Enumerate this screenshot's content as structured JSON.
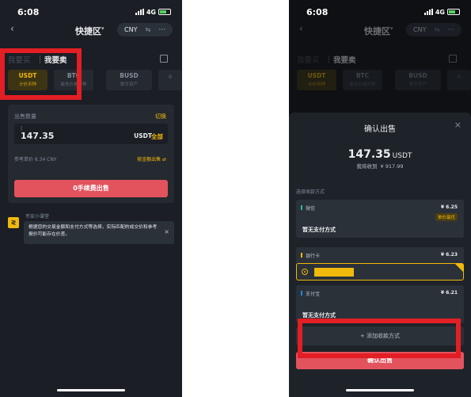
{
  "left": {
    "status": {
      "time": "6:08",
      "network": "4G"
    },
    "nav": {
      "back": "‹",
      "title": "快捷区",
      "caret": "▾",
      "currency": "CNY",
      "swap": "⇆",
      "more": "···"
    },
    "tabs": {
      "buy": "我要买",
      "sell": "我要卖"
    },
    "coins": [
      {
        "symbol": "USDT",
        "sub": "计价币种"
      },
      {
        "symbol": "BTC",
        "sub": "最低价格币种"
      },
      {
        "symbol": "BUSD",
        "sub": "数字资产"
      },
      {
        "symbol": "",
        "sub": "币"
      }
    ],
    "sell_card": {
      "label": "出售数量",
      "switch_label": "切换",
      "cursor": "|",
      "amount": "147.35",
      "unit": "USDT",
      "all_label": "全部",
      "ref_price": "参考单价 6.34 CNY",
      "mode": "按金额出售 ⇄",
      "button": "0手续费出售"
    },
    "tips": {
      "icon": "≷",
      "title": "币安小课堂",
      "text": "根据您的交易金额和支付方式等选择，实际匹配的成交价和参考报价可能存在价差。",
      "close": "×"
    }
  },
  "right": {
    "status": {
      "time": "6:08",
      "network": "4G"
    },
    "nav": {
      "back": "‹",
      "title": "快捷区",
      "caret": "▾",
      "currency": "CNY",
      "swap": "⇆",
      "more": "···"
    },
    "tabs": {
      "buy": "我要买",
      "sell": "我要卖"
    },
    "coins": [
      {
        "symbol": "USDT",
        "sub": "计价币种"
      },
      {
        "symbol": "BTC",
        "sub": "最低价格币种"
      },
      {
        "symbol": "BUSD",
        "sub": "数字资产"
      },
      {
        "symbol": "",
        "sub": "币"
      }
    ],
    "sheet": {
      "title": "确认出售",
      "close": "×",
      "amount": "147.35",
      "currency": "USDT",
      "receive_label": "我将收到",
      "receive_value": "¥ 917.99",
      "method_label": "选择收款方式",
      "methods": [
        {
          "name": "微信",
          "price": "¥ 6.25",
          "badge": "单价最优",
          "status": "暂无支付方式",
          "color": "#2ebd85"
        },
        {
          "name": "银行卡",
          "price": "¥ 6.23",
          "color": "#f0b90b"
        },
        {
          "name": "支付宝",
          "price": "¥ 6.21",
          "status": "暂无支付方式",
          "color": "#1e88e5"
        }
      ],
      "add_method": "+ 添加收款方式",
      "confirm": "确认出售"
    }
  },
  "colors": {
    "brand_yellow": "#f0b90b",
    "sell_red": "#e2535e",
    "highlight_red": "#e31e24"
  }
}
